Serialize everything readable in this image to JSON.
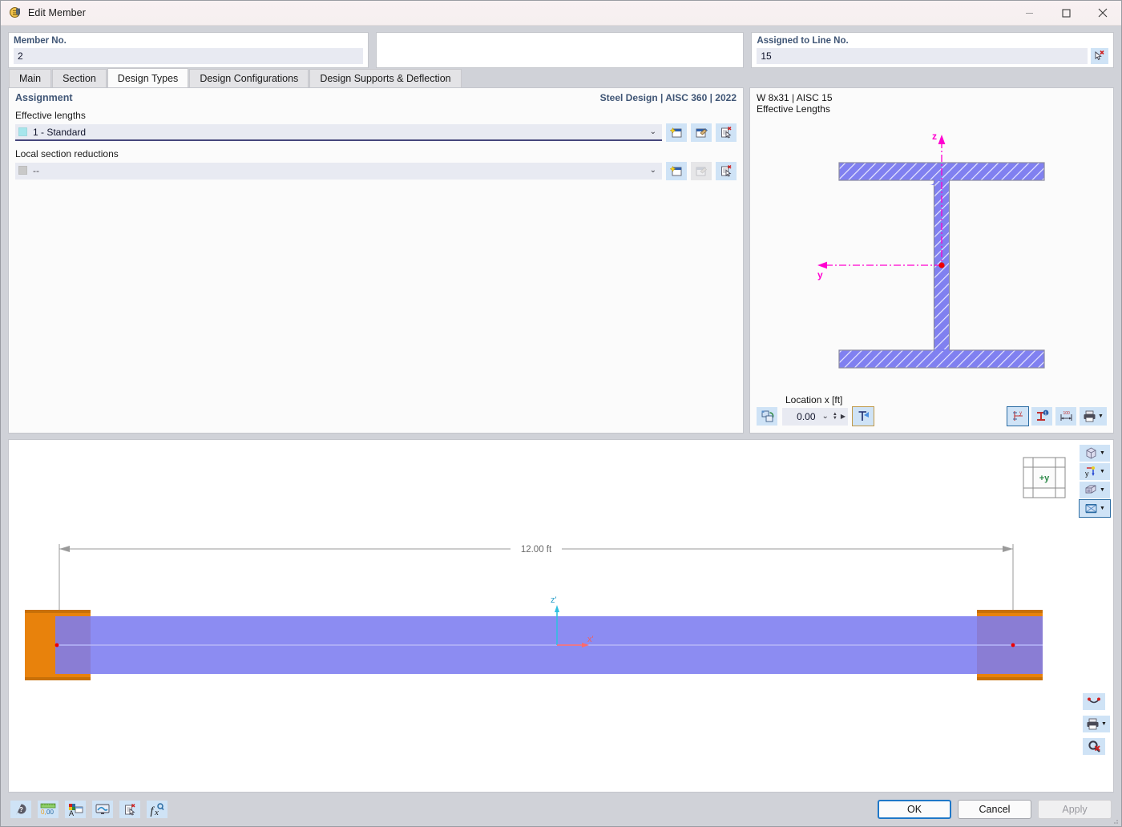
{
  "window": {
    "title": "Edit Member",
    "app_icon": "member-icon",
    "minimize_label": "—",
    "maximize_label": "□",
    "close_label": "✕"
  },
  "header": {
    "member": {
      "label": "Member No.",
      "value": "2"
    },
    "middle": {
      "label": "",
      "value": ""
    },
    "line": {
      "label": "Assigned to Line No.",
      "value": "15",
      "pick_icon": "select-line-icon"
    }
  },
  "tabs": [
    {
      "label": "Main",
      "active": false
    },
    {
      "label": "Section",
      "active": false
    },
    {
      "label": "Design Types",
      "active": true
    },
    {
      "label": "Design Configurations",
      "active": false
    },
    {
      "label": "Design Supports & Deflection",
      "active": false
    }
  ],
  "assignment": {
    "title": "Assignment",
    "standard": "Steel Design | AISC 360 | 2022",
    "fields": [
      {
        "label": "Effective lengths",
        "value": "1 - Standard",
        "swatch": "#a7e6ec",
        "arrow": "⌄",
        "buttons": [
          {
            "name": "new-effective-length-button",
            "enabled": true
          },
          {
            "name": "edit-effective-length-button",
            "enabled": true
          },
          {
            "name": "delete-effective-length-button",
            "enabled": true
          }
        ]
      },
      {
        "label": "Local section reductions",
        "value": "--",
        "swatch": "#c9c9c9",
        "arrow": "⌄",
        "buttons": [
          {
            "name": "new-section-reduction-button",
            "enabled": true
          },
          {
            "name": "edit-section-reduction-button",
            "enabled": false
          },
          {
            "name": "delete-section-reduction-button",
            "enabled": true
          }
        ]
      }
    ]
  },
  "section_view": {
    "caption_line1": "W 8x31 | AISC 15",
    "caption_line2": "Effective Lengths",
    "axis_z_label": "z",
    "axis_y_label": "y",
    "axis_color": "#ff00d0",
    "section_fill": "#8080f0",
    "section_stroke": "#8a8aa0",
    "location": {
      "label": "Location x [ft]",
      "value": "0.00",
      "dropdown_arrow": "⌄",
      "stepper_up": "▲",
      "stepper_down": "▼",
      "next_arrow": "▶"
    },
    "toolbar_left": [
      {
        "name": "swap-view-icon"
      }
    ],
    "toolbar_right": [
      {
        "name": "show-axes-icon",
        "selected": true
      },
      {
        "name": "section-properties-icon",
        "selected": false
      },
      {
        "name": "show-dimensions-icon",
        "selected": false
      },
      {
        "name": "print-section-icon",
        "selected": false
      }
    ]
  },
  "viewport": {
    "dimension_label": "12.00 ft",
    "axis_z_label": "z'",
    "axis_x_label": "x'",
    "navcube_label": "+y",
    "member_color": "#7c7cf0",
    "support_color": "#e8820c",
    "toolbar": [
      {
        "name": "view-mode-button",
        "icon": "cube-icon",
        "selected": false
      },
      {
        "name": "axis-orientation-button",
        "icon": "axis-icon",
        "selected": false
      },
      {
        "name": "render-style-button",
        "icon": "render-icon",
        "selected": false
      },
      {
        "name": "display-model-button",
        "icon": "model-icon",
        "selected": true
      }
    ],
    "toolbar_bottom": [
      {
        "name": "view-points-button",
        "icon": "smiley-icon"
      },
      {
        "name": "print-view-button",
        "icon": "printer-icon"
      },
      {
        "name": "reset-zoom-button",
        "icon": "zoom-reset-icon"
      }
    ]
  },
  "statusbar": {
    "buttons": [
      {
        "name": "help-button",
        "icon": "help-icon"
      },
      {
        "name": "units-button",
        "icon": "units-icon",
        "text": "0,00"
      },
      {
        "name": "display-properties-button",
        "icon": "display-props-icon"
      },
      {
        "name": "view-settings-button",
        "icon": "monitor-icon"
      },
      {
        "name": "delete-entry-button",
        "icon": "delete-doc-icon"
      },
      {
        "name": "formula-button",
        "icon": "function-icon"
      }
    ],
    "ok_label": "OK",
    "cancel_label": "Cancel",
    "apply_label": "Apply",
    "apply_enabled": false
  }
}
